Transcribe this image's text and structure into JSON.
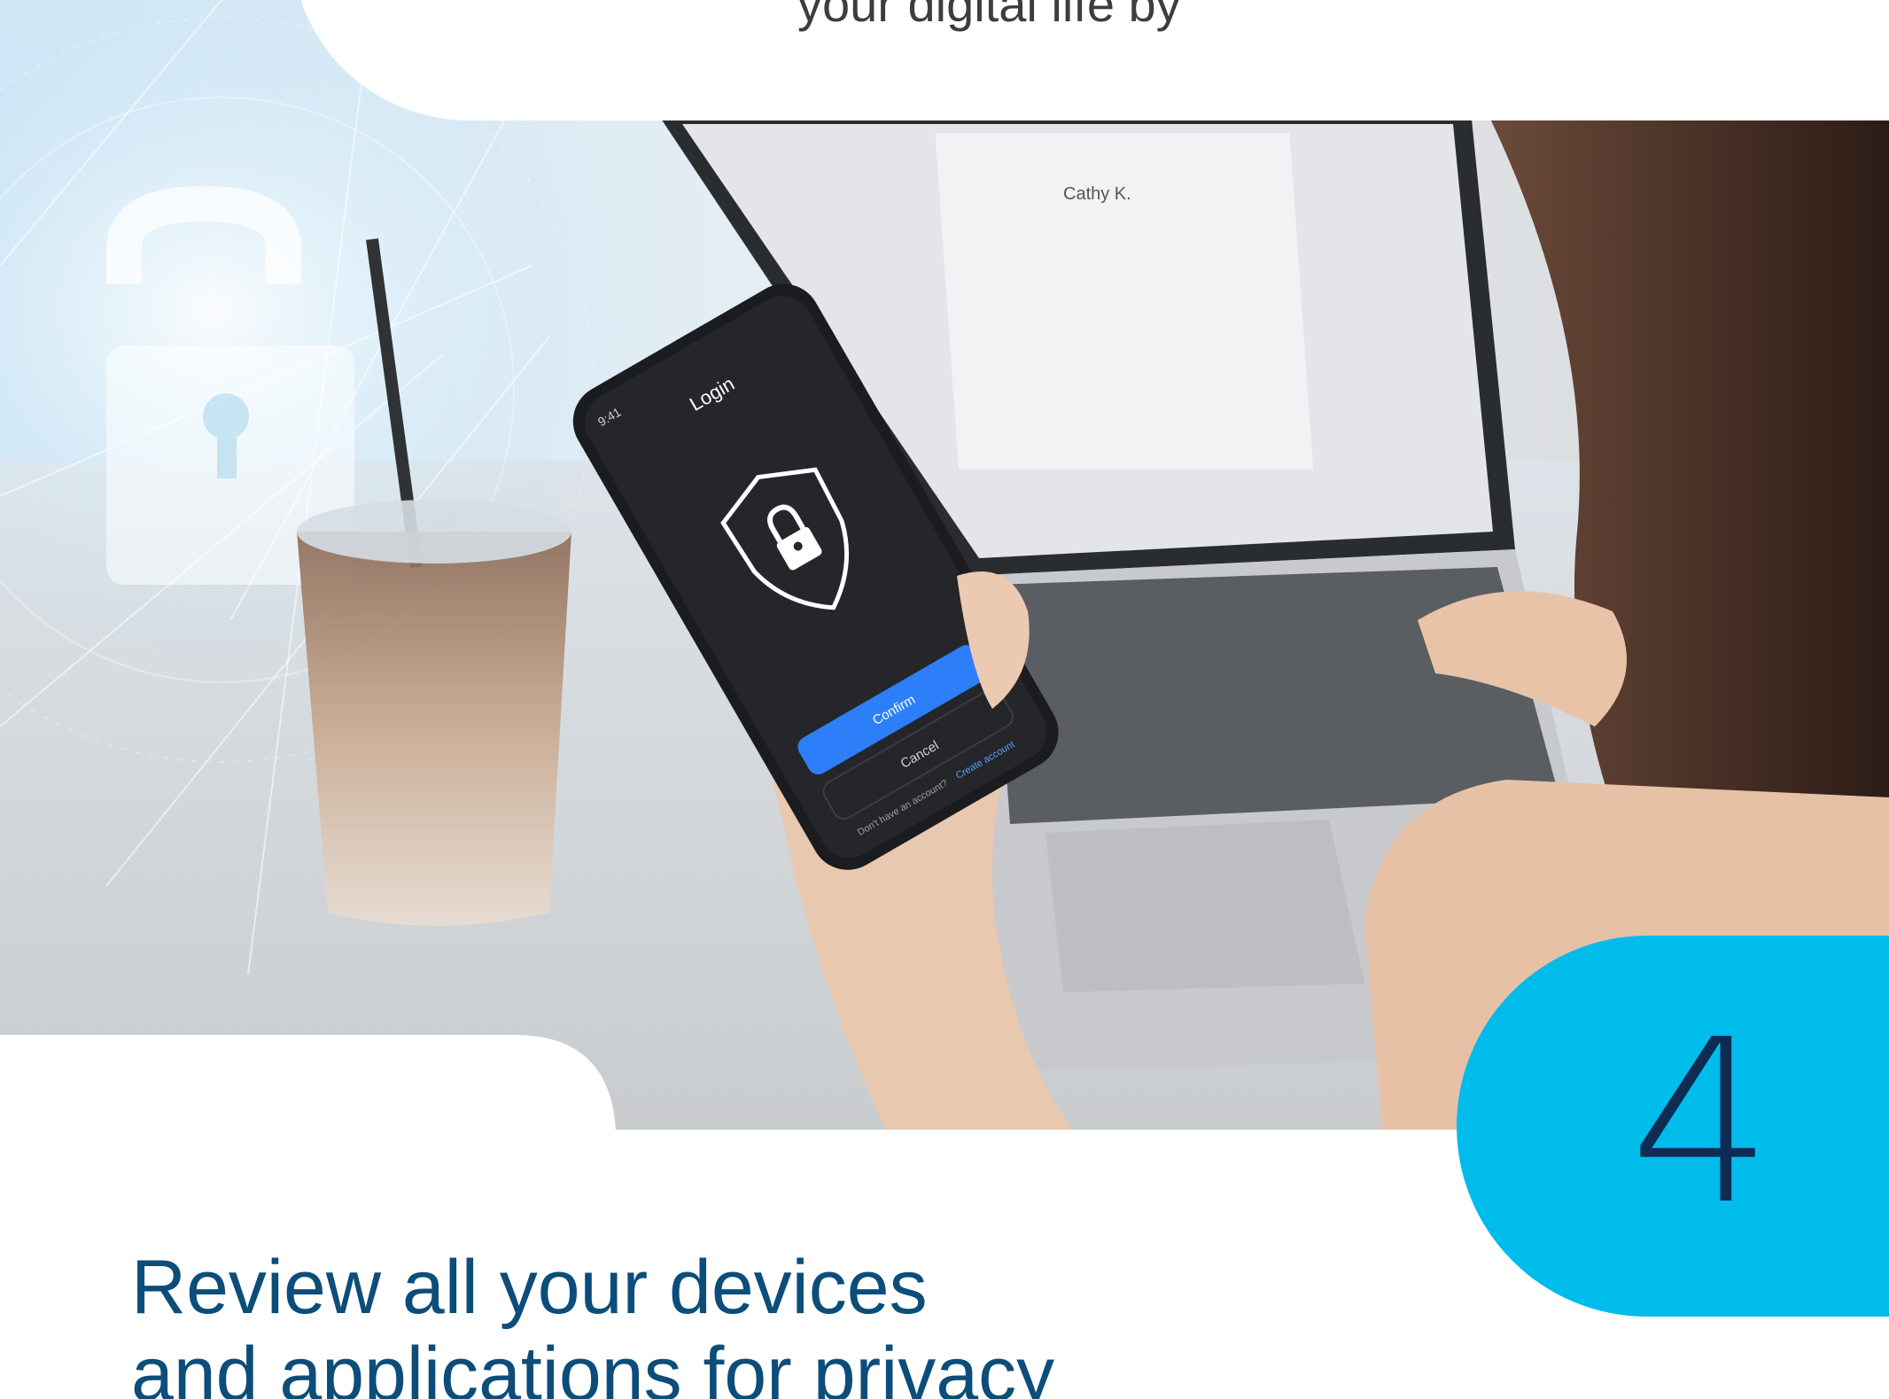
{
  "header": {
    "partial_text": "your digital life by"
  },
  "photo": {
    "description_icons": [
      "padlock-icon",
      "shield-lock-icon"
    ],
    "phone": {
      "time": "9:41",
      "screen_title": "Login",
      "confirm_label": "Confirm",
      "cancel_label": "Cancel",
      "footer_text": "Don't have an account?",
      "footer_link": "Create account"
    },
    "laptop": {
      "user_name": "Cathy K."
    }
  },
  "step": {
    "number": "4"
  },
  "headline": {
    "line1": "Review all your devices",
    "line2": "and applications for privacy"
  },
  "colors": {
    "badge": "#00bceb",
    "number": "#0d2c54",
    "headline": "#0c4d7a"
  }
}
